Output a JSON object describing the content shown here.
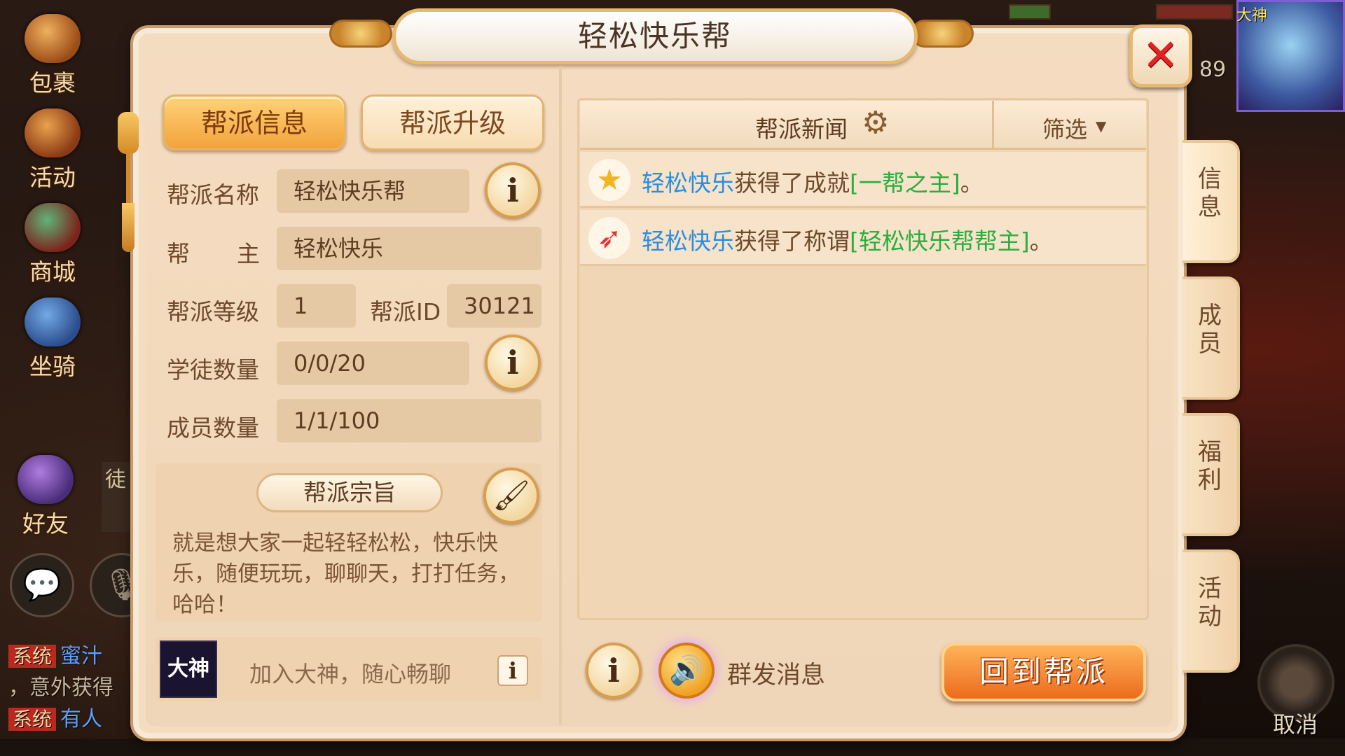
{
  "panel": {
    "title": "轻松快乐帮",
    "close_icon": "✕"
  },
  "tabs": {
    "info_label": "帮派信息",
    "upgrade_label": "帮派升级"
  },
  "guild_info": {
    "name_label": "帮派名称",
    "name_value": "轻松快乐帮",
    "leader_label_1": "帮",
    "leader_label_2": "主",
    "leader_value": "轻松快乐",
    "level_label": "帮派等级",
    "level_value": "1",
    "id_label": "帮派ID",
    "id_value": "30121",
    "apprentice_label": "学徒数量",
    "apprentice_value": "0/0/20",
    "member_label": "成员数量",
    "member_value": "1/1/100"
  },
  "motto": {
    "title": "帮派宗旨",
    "text": "就是想大家一起轻轻松松，快乐快乐，随便玩玩，聊聊天，打打任务，哈哈！"
  },
  "dashen": {
    "logo_text": "大神",
    "prompt": "加入大神，随心畅聊"
  },
  "news": {
    "title": "帮派新闻",
    "filter_label": "筛选",
    "items": [
      {
        "icon": "star-icon",
        "name": "轻松快乐",
        "verb": "获得了成就",
        "highlight": "[一帮之主]",
        "end": "。"
      },
      {
        "icon": "wing-icon",
        "name": "轻松快乐",
        "verb": "获得了称谓",
        "highlight": "[轻松快乐帮帮主]",
        "end": "。"
      }
    ]
  },
  "footer": {
    "broadcast_label": "群发消息",
    "return_label": "回到帮派"
  },
  "side_tabs": [
    {
      "label": "信息",
      "active": true
    },
    {
      "label": "成员",
      "active": false
    },
    {
      "label": "福利",
      "active": false
    },
    {
      "label": "活动",
      "active": false
    }
  ],
  "background": {
    "left_icons": [
      "包裹",
      "活动",
      "商城",
      "坐骑"
    ],
    "friend_label": "好友",
    "apprentice_tag": "徒",
    "chat_lines": [
      {
        "tag": "系统",
        "name": "蜜汁",
        "text": ""
      },
      {
        "tag": "",
        "name": "",
        "text": "，意外获得"
      },
      {
        "tag": "系统",
        "name": "有人",
        "text": ""
      }
    ],
    "player_level": "89",
    "avatar_tag": "大神",
    "cancel_label": "取消"
  },
  "colors": {
    "panel_bg": "#f3dcbf",
    "accent_orange": "#ec6b1c",
    "name_blue": "#2a8de0",
    "highlight_green": "#2aae3e",
    "close_red": "#e52222"
  }
}
